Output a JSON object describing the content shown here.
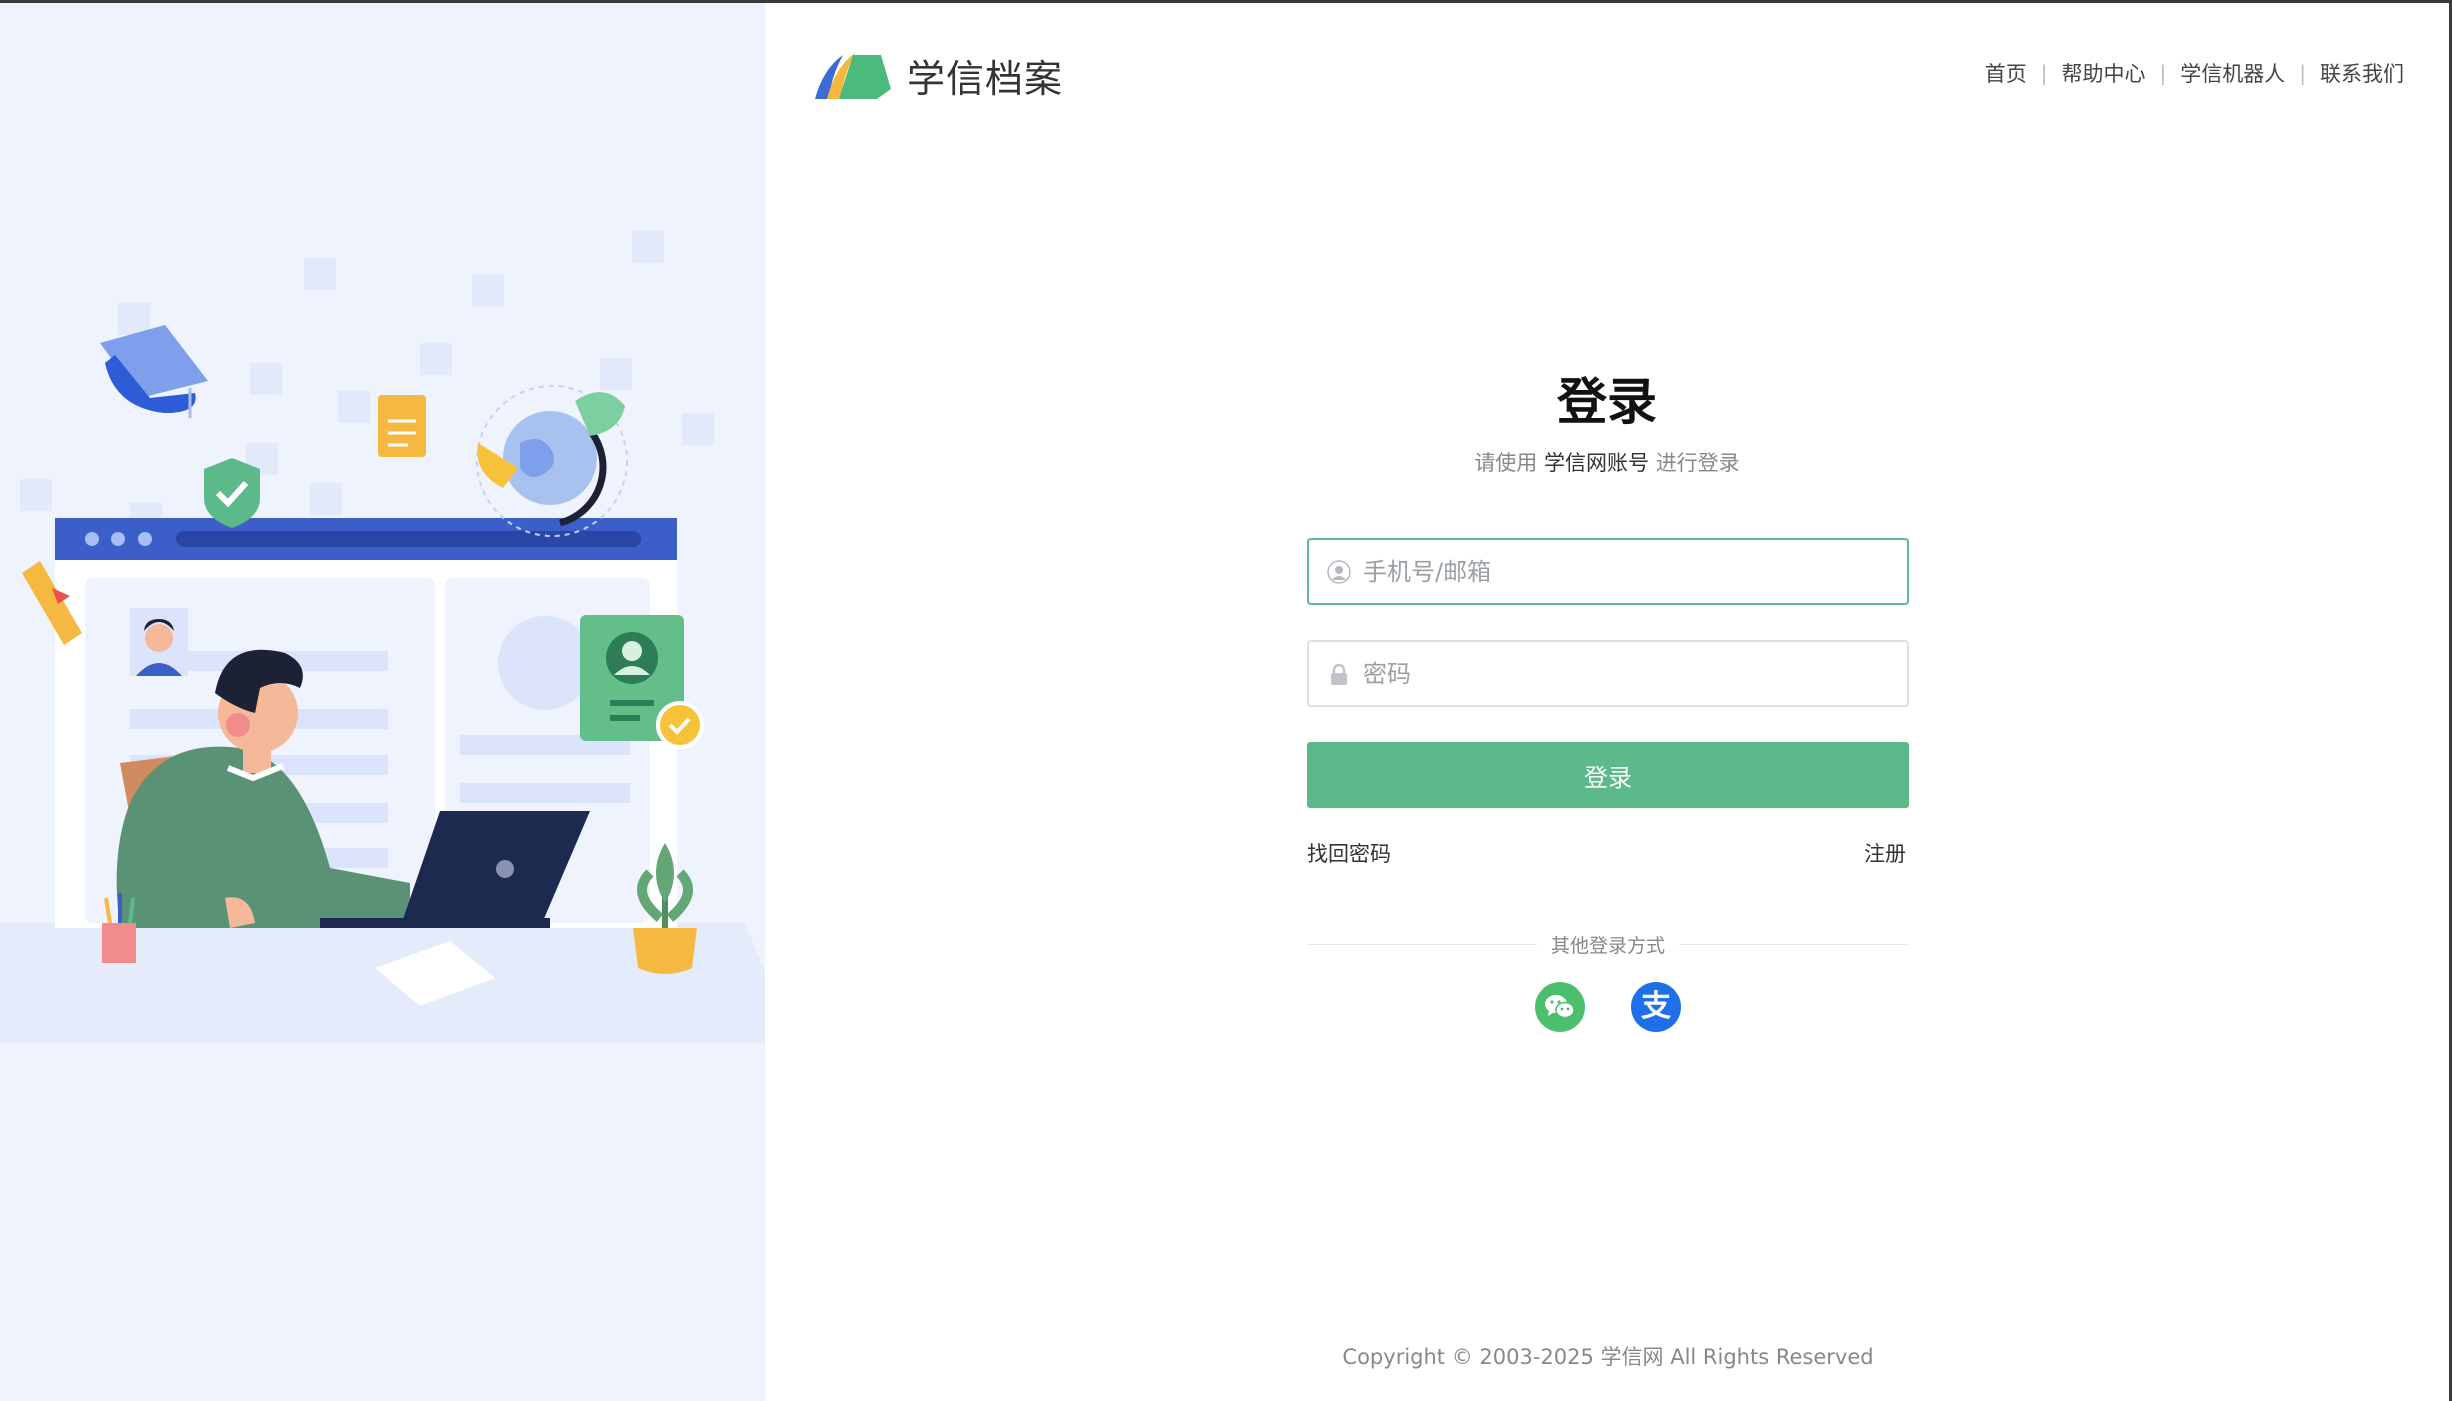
{
  "header": {
    "logo_text": "学信档案",
    "nav": [
      "首页",
      "帮助中心",
      "学信机器人",
      "联系我们"
    ]
  },
  "login": {
    "title": "登录",
    "subtitle_prefix": "请使用",
    "subtitle_account": "学信网账号",
    "subtitle_suffix": "进行登录",
    "username_placeholder": "手机号/邮箱",
    "username_value": "",
    "password_placeholder": "密码",
    "password_value": "",
    "submit_label": "登录",
    "forgot_label": "找回密码",
    "register_label": "注册",
    "other_methods_label": "其他登录方式"
  },
  "social": [
    {
      "icon": "wechat-icon",
      "color": "#4cbf6e"
    },
    {
      "icon": "alipay-icon",
      "color": "#1f6fe8"
    }
  ],
  "footer": {
    "copyright": "Copyright © 2003-2025  学信网  All Rights Reserved"
  },
  "colors": {
    "accent": "#5bb98a",
    "panel_bg": "#eef3fd"
  }
}
